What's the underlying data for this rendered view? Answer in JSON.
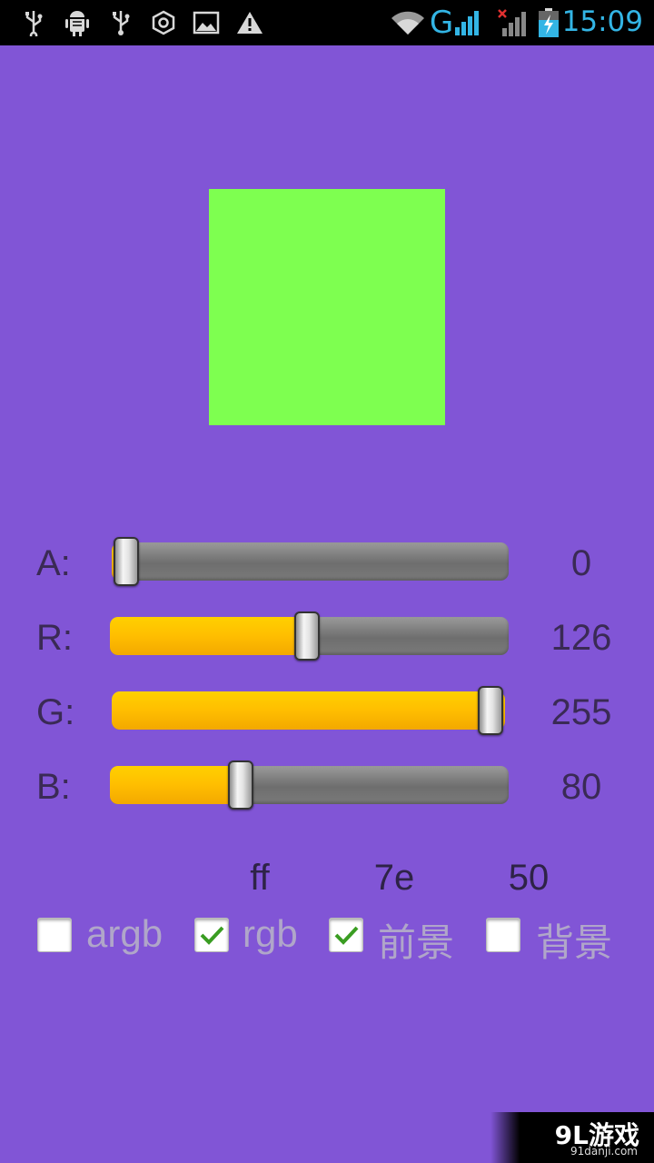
{
  "status_bar": {
    "time": "15:09",
    "network_label": "G",
    "clock_color": "#33b5e5",
    "icons": [
      "usb-icon",
      "android-debug-icon",
      "usb-icon",
      "settings-hex-icon",
      "image-icon",
      "warning-icon",
      "wifi-icon",
      "signal-icon",
      "no-signal-icon",
      "battery-charging-icon"
    ]
  },
  "preview": {
    "color": "#7eff50"
  },
  "sliders": [
    {
      "label": "A:",
      "value": "0",
      "fraction": 0
    },
    {
      "label": "R:",
      "value": "126",
      "fraction": 0.494
    },
    {
      "label": "G:",
      "value": "255",
      "fraction": 1
    },
    {
      "label": "B:",
      "value": "80",
      "fraction": 0.314
    }
  ],
  "hex": {
    "r": "ff",
    "g": "7e",
    "b": "50"
  },
  "checkboxes": [
    {
      "label": "argb",
      "checked": false
    },
    {
      "label": "rgb",
      "checked": true
    },
    {
      "label": "前景",
      "checked": true
    },
    {
      "label": "背景",
      "checked": false
    }
  ],
  "watermark": {
    "title": "9L游戏",
    "subtitle": "91danji.com"
  },
  "colors": {
    "background": "#8155d6",
    "accent": "#ffbe00",
    "check": "#3a9d22"
  }
}
